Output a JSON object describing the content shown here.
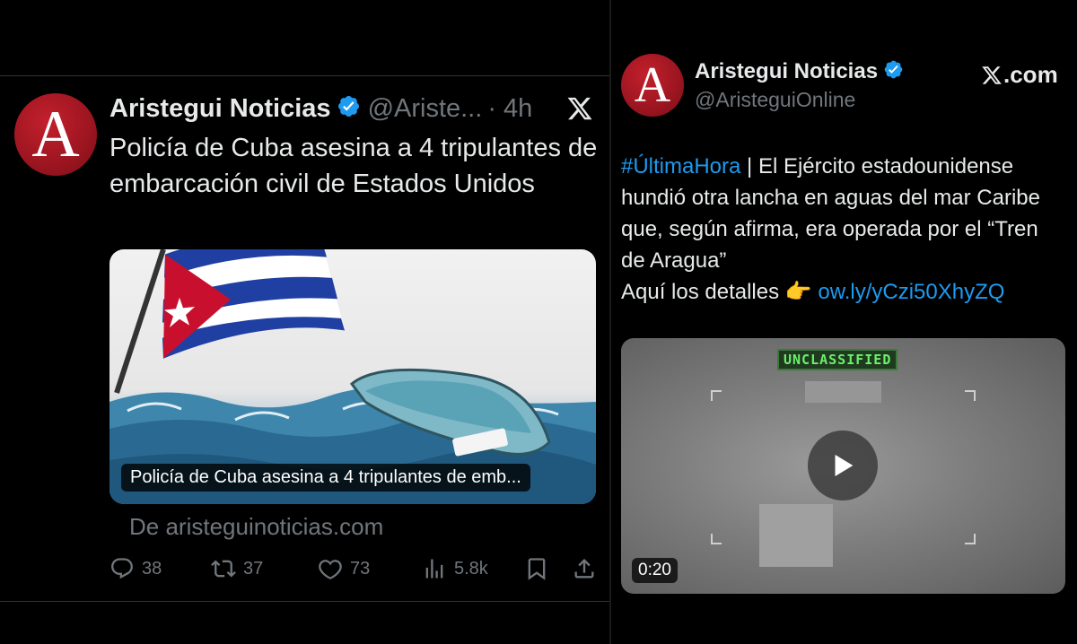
{
  "left_tweet": {
    "author_name": "Aristegui Noticias",
    "handle": "@Ariste...",
    "time": "· 4h",
    "avatar_letter": "A",
    "text": "Policía de Cuba asesina a 4 tripulantes de embarcación civil de Estados Unidos",
    "card": {
      "caption": "Policía de Cuba asesina a 4 tripulantes de emb...",
      "domain": "De aristeguinoticias.com"
    },
    "actions": {
      "replies": "38",
      "reposts": "37",
      "likes": "73",
      "views": "5.8k"
    }
  },
  "right_tweet": {
    "author_name": "Aristegui Noticias",
    "handle": "@AristeguiOnline",
    "source": ".com",
    "avatar_letter": "A",
    "hashtag": "#ÚltimaHora",
    "text_after_hashtag": " | El Ejército estadounidense hundió otra lancha en aguas del mar Caribe que, según afirma, era operada por el “Tren de Aragua”",
    "details_label": "Aquí los detalles ",
    "details_emoji": "👉",
    "link": "ow.ly/yCzi50XhyZQ",
    "video": {
      "overlay_label": "UNCLASSIFIED",
      "duration": "0:20"
    }
  },
  "colors": {
    "background": "#000000",
    "text": "#e7e9ea",
    "secondary": "#71767b",
    "accent": "#1d9bf0",
    "avatar_red": "#c3202c"
  }
}
